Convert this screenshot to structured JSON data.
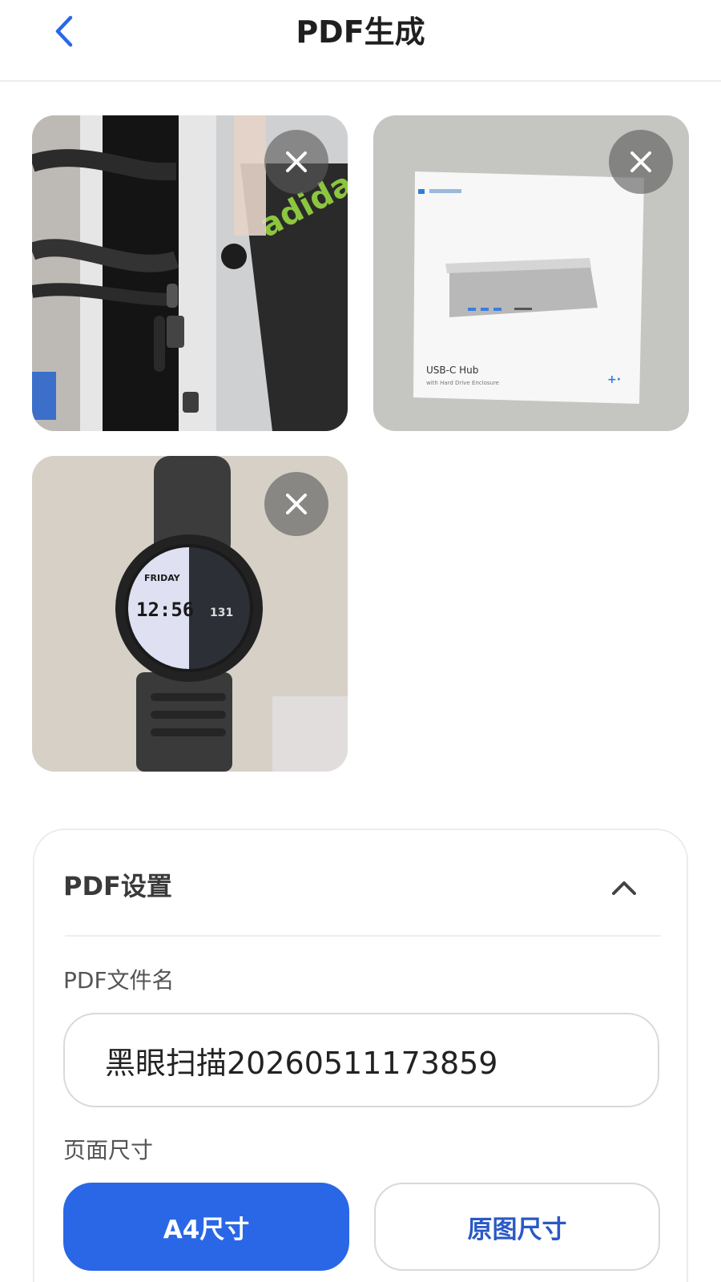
{
  "header": {
    "title": "PDF生成",
    "back_icon": "chevron-left-icon"
  },
  "colors": {
    "accent": "#2a67e6",
    "accent_text": "#2a59c5"
  },
  "images": [
    {
      "name": "macmini-ports-photo",
      "remove_icon": "close-icon"
    },
    {
      "name": "usb-c-hub-box-photo",
      "remove_icon": "close-icon"
    },
    {
      "name": "smartwatch-photo",
      "remove_icon": "close-icon"
    }
  ],
  "settings": {
    "title": "PDF设置",
    "collapse_icon": "chevron-up-icon",
    "filename_label": "PDF文件名",
    "filename_value": "黑眼扫描20260511173859",
    "page_size_label": "页面尺寸",
    "page_size_options": [
      "A4尺寸",
      "原图尺寸"
    ],
    "page_size_selected": "A4尺寸"
  }
}
